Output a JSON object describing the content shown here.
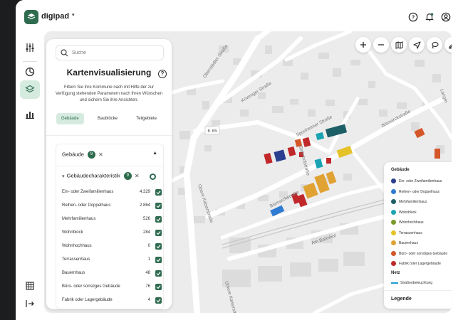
{
  "app": {
    "name": "digipad"
  },
  "search": {
    "placeholder": "Suche"
  },
  "panel": {
    "title": "Kartenvisualisierung",
    "description": "Filtern Sie ihre Kommune nach mit Hilfe der zur Verfügung stehenden Parametern nach Ihren Wünschen und sichern Sie ihre Ansichten.",
    "tabs": [
      "Gebäude",
      "Baublöcke",
      "Teilgebiete"
    ],
    "active_tab": "Gebäude",
    "section": {
      "title": "Gebäude",
      "count": "9"
    },
    "subsection": {
      "title": "Gebäudecharakteristik",
      "count": "9"
    },
    "rows": [
      {
        "label": "Ein- oder Zweifamilienhaus",
        "count": "4.329"
      },
      {
        "label": "Reihen- oder Doppelhaus",
        "count": "2.864"
      },
      {
        "label": "Mehrfamilienhaus",
        "count": "526"
      },
      {
        "label": "Wohnblock",
        "count": "284"
      },
      {
        "label": "Wohnhochhaus",
        "count": "0"
      },
      {
        "label": "Terrassenhaus",
        "count": "1"
      },
      {
        "label": "Bauernhaus",
        "count": "48"
      },
      {
        "label": "Büro- oder sonstiges Gebäude",
        "count": "76"
      },
      {
        "label": "Fabrik oder Lagergebäude",
        "count": "4"
      }
    ]
  },
  "map": {
    "streets": [
      "Oberstädter Straße",
      "Kövenger Straße",
      "Sponheimer Straße",
      "Bismarckstraße",
      "Bismarckstraße",
      "Obere Kaiserstraße",
      "Untere Kaiserstraße",
      "Am Bahnhof",
      "Langer",
      "Bahnhofstraße",
      "K 65"
    ]
  },
  "legend": {
    "title": "Gebäude",
    "items": [
      {
        "label": "Ein- oder Zweifamilienhaus",
        "color": "#2a3f8f"
      },
      {
        "label": "Reihen- oder Doppelhaus",
        "color": "#2e7bd1"
      },
      {
        "label": "Mehrfamilienhaus",
        "color": "#1d5f67"
      },
      {
        "label": "Wohnblock",
        "color": "#1aa3b3"
      },
      {
        "label": "Wohnhochhaus",
        "color": "#7a9a2a"
      },
      {
        "label": "Terrassenhaus",
        "color": "#e6c229"
      },
      {
        "label": "Bauernhaus",
        "color": "#e0a233"
      },
      {
        "label": "Büro- oder sonstiges Gebäude",
        "color": "#d4572a"
      },
      {
        "label": "Fabrik oder Lagergebäude",
        "color": "#c0282a"
      }
    ],
    "net_title": "Netz",
    "net_items": [
      {
        "label": "Straßenbeleuchtung",
        "color": "#1f9ad6"
      }
    ],
    "footer": "Legende"
  }
}
